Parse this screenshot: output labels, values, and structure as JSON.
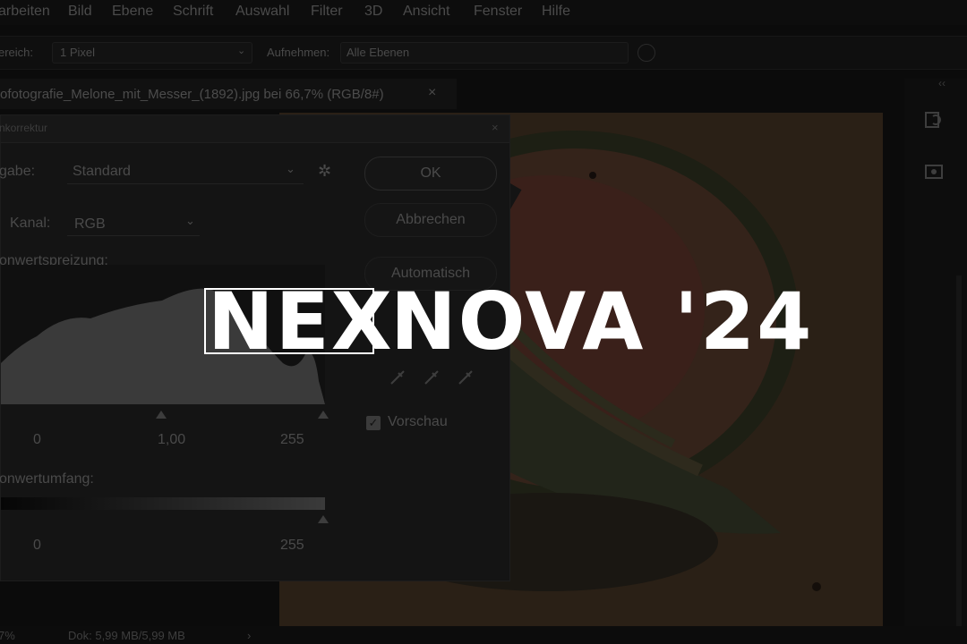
{
  "menu": [
    "arbeiten",
    "Bild",
    "Ebene",
    "Schrift",
    "Auswahl",
    "Filter",
    "3D",
    "Ansicht",
    "Fenster",
    "Hilfe"
  ],
  "options_bar": {
    "sample_label": "ereich:",
    "sample_value": "1 Pixel",
    "sample_mode_label": "Aufnehmen:",
    "sample_mode_value": "Alle Ebenen"
  },
  "document_tab": {
    "title": "ofotografie_Melone_mit_Messer_(1892).jpg bei 66,7% (RGB/8#)",
    "close": "×"
  },
  "dialog": {
    "title": "nkorrektur",
    "preset_label": "gabe:",
    "preset_value": "Standard",
    "channel_label": "Kanal:",
    "channel_value": "RGB",
    "input_levels_label": "onwertspreizung:",
    "input_black": "0",
    "input_gamma": "1,00",
    "input_white": "255",
    "output_levels_label": "onwertumfang:",
    "output_black": "0",
    "output_white": "255",
    "ok_label": "OK",
    "cancel_label": "Abbrechen",
    "auto_label": "Automatisch",
    "preview_label": "Vorschau",
    "preview_checked": true
  },
  "status_bar": {
    "zoom": "7%",
    "doc_info": "Dok: 5,99 MB/5,99 MB"
  },
  "logo": {
    "part1": "NEX",
    "part2": "NOVA '24"
  },
  "colors": {
    "overlay": "#0b0b0b",
    "logo": "#ffffff"
  }
}
